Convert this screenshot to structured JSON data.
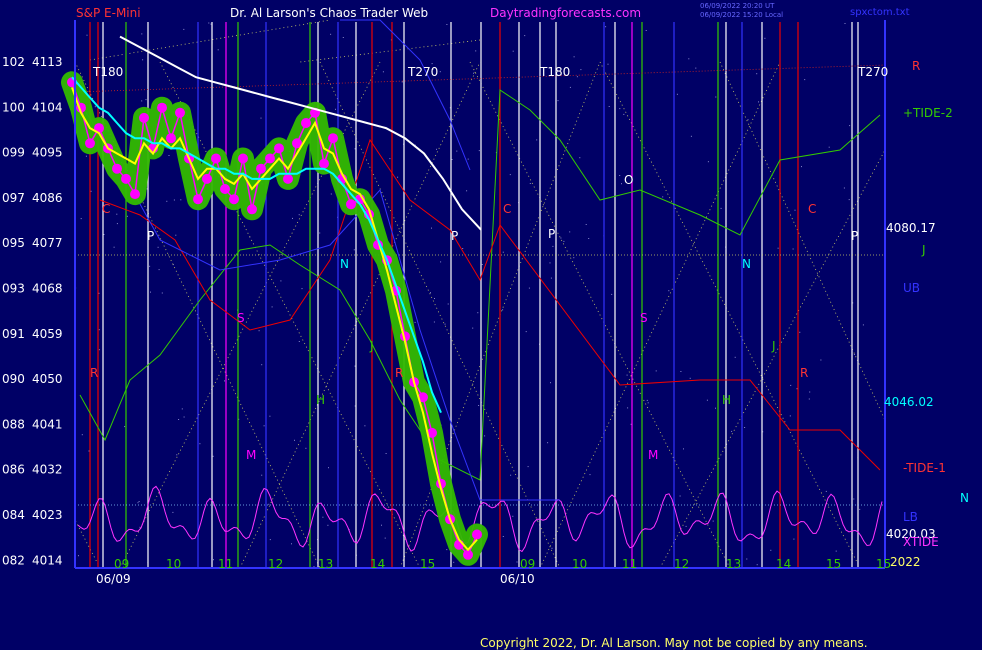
{
  "header": {
    "instrument": "S&P E-Mini",
    "site": "Dr. Al Larson's Chaos Trader Web",
    "url": "Daytradingforecasts.com",
    "time1": "06/09/2022 20:20 UT",
    "time2": "06/09/2022 15:20 Local",
    "file": "spxctom.txt"
  },
  "copyright": "Copyright 2022, Dr. Al Larson. May not be copied by any means.",
  "colors": {
    "background": "#000066",
    "price_bars": "#ff00ff",
    "price_highlight": "#33bb00",
    "avg_fast": "#ffff00",
    "avg_mid": "#00ffff",
    "avg_slow": "#ffffff",
    "tide": "#33cc00",
    "xtide": "#ff33ff",
    "red_line": "#ee0000",
    "blue_line": "#3333ff",
    "green_line": "#33cc00"
  },
  "chart_data": {
    "type": "line",
    "y_left_labels": [
      "102",
      "100",
      "099",
      "097",
      "095",
      "093",
      "091",
      "090",
      "088",
      "086",
      "084",
      "082"
    ],
    "y_right_labels": [
      "4113",
      "4104",
      "4095",
      "4086",
      "4077",
      "4068",
      "4059",
      "4050",
      "4041",
      "4032",
      "4023",
      "4014"
    ],
    "ylim": [
      4014,
      4113
    ],
    "x_hour_labels": [
      "09",
      "10",
      "11",
      "12",
      "13",
      "14",
      "15",
      "09",
      "10",
      "11",
      "12",
      "13",
      "14",
      "15",
      "15"
    ],
    "date_labels": [
      "06/09",
      "06/10"
    ],
    "year_label": "2022",
    "turn_labels": [
      "T180",
      "T270",
      "T180",
      "T270"
    ],
    "right_labels": [
      {
        "text": "R",
        "color": "#ff3333"
      },
      {
        "text": "+TIDE-2",
        "color": "#33cc00"
      },
      {
        "text": "4080.17",
        "color": "#ffffff"
      },
      {
        "text": "J",
        "color": "#33cc00"
      },
      {
        "text": "UB",
        "color": "#3333ff"
      },
      {
        "text": "4046.02",
        "color": "#00ffff"
      },
      {
        "text": "-TIDE-1",
        "color": "#ff3333"
      },
      {
        "text": "N",
        "color": "#00ffff"
      },
      {
        "text": "LB",
        "color": "#3333ff"
      },
      {
        "text": "4020.03",
        "color": "#ffffff"
      },
      {
        "text": "XTIDE",
        "color": "#ff33ff"
      }
    ],
    "planet_markers": [
      {
        "text": "C",
        "color": "#ff3333"
      },
      {
        "text": "P",
        "color": "#ffffff"
      },
      {
        "text": "N",
        "color": "#00ffff"
      },
      {
        "text": "S",
        "color": "#ff00ff"
      },
      {
        "text": "J",
        "color": "#33cc00"
      },
      {
        "text": "H",
        "color": "#33cc00"
      },
      {
        "text": "R",
        "color": "#ff3333"
      },
      {
        "text": "M",
        "color": "#ff00ff"
      },
      {
        "text": "O",
        "color": "#ffffff"
      }
    ],
    "series": [
      {
        "values": [
          4109,
          4104,
          4097,
          4100,
          4096,
          4092,
          4090,
          4087,
          4102,
          4096,
          4104,
          4098,
          4103,
          4094,
          4086,
          4090,
          4094,
          4088,
          4086,
          4094,
          4084,
          4092,
          4094,
          4096,
          4090,
          4097,
          4101,
          4103,
          4093,
          4098,
          4090,
          4085,
          4086,
          4083,
          4077,
          4074,
          4068,
          4059,
          4050,
          4047,
          4040,
          4030,
          4023,
          4018,
          4016,
          4020
        ]
      },
      {
        "values": [
          4108,
          4103,
          4100,
          4099,
          4096,
          4095,
          4094,
          4093,
          4097,
          4095,
          4098,
          4096,
          4098,
          4094,
          4090,
          4092,
          4092,
          4090,
          4089,
          4091,
          4088,
          4090,
          4092,
          4094,
          4092,
          4095,
          4098,
          4101,
          4096,
          4095,
          4091,
          4088,
          4087,
          4084,
          4078,
          4072,
          4065,
          4058,
          4050,
          4044,
          4036,
          4029,
          4023,
          4019,
          4017,
          4019
        ]
      },
      {
        "values": [
          4110,
          4108,
          4106,
          4104,
          4103,
          4101,
          4099,
          4098,
          4098,
          4097,
          4097,
          4096,
          4096,
          4095,
          4094,
          4093,
          4092,
          4092,
          4091,
          4091,
          4090,
          4090,
          4090,
          4091,
          4091,
          4091,
          4092,
          4092,
          4092,
          4091,
          4089,
          4087,
          4085,
          4082,
          4078,
          4074,
          4069,
          4064,
          4059,
          4054,
          4048,
          4044
        ]
      },
      {
        "values": [
          4118,
          4116,
          4114,
          4112,
          4110,
          4109,
          4108,
          4107,
          4106,
          4105,
          4104,
          4103,
          4102,
          4101,
          4100,
          4098,
          4095,
          4090,
          4084,
          4080
        ]
      }
    ]
  }
}
